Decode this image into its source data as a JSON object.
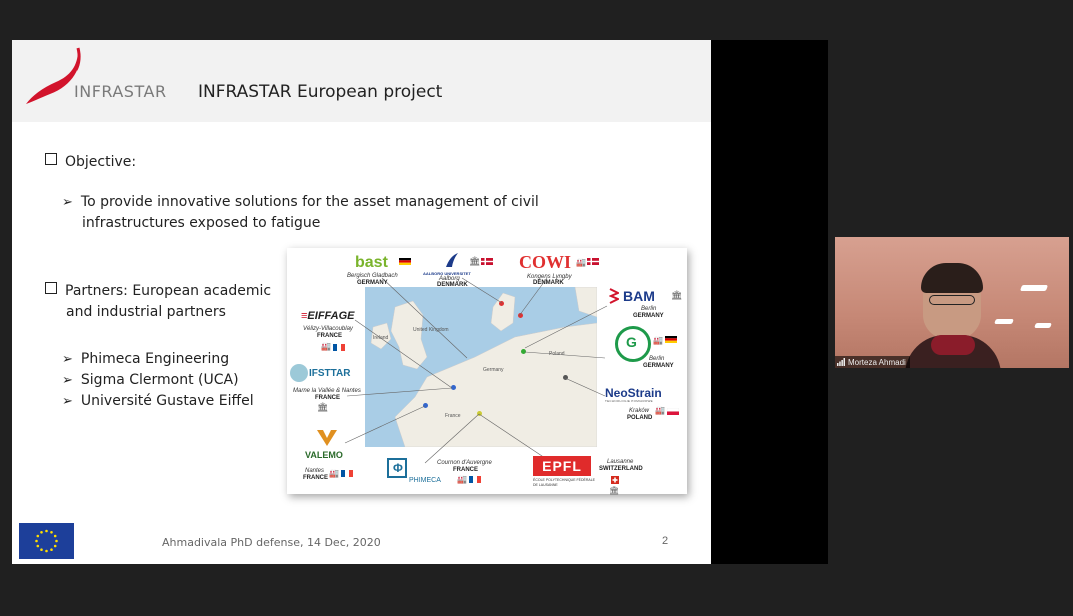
{
  "slide": {
    "logo_text": "INFRASTAR",
    "title": "INFRASTAR European project",
    "objective_heading": "Objective:",
    "objective_line1": "To provide innovative solutions for the asset management of civil",
    "objective_line2": "infrastructures exposed to fatigue",
    "partners_heading_line1": "Partners: European academic",
    "partners_heading_line2": "and industrial partners",
    "partners": [
      "Phimeca Engineering",
      "Sigma Clermont (UCA)",
      "Université Gustave Eiffel"
    ],
    "footer": "Ahmadivala PhD defense, 14 Dec, 2020",
    "page_number": "2"
  },
  "map_figure": {
    "labels": {
      "bast": {
        "brand": "bast",
        "city": "Bergisch Gladbach",
        "country": "GERMANY"
      },
      "aalborg": {
        "brand": "AALBORG UNIVERSITET",
        "city": "Aalborg",
        "country": "DENMARK"
      },
      "cowi": {
        "brand": "COWI",
        "city": "Kongens Lyngby",
        "country": "DENMARK"
      },
      "eiffage": {
        "brand": "EIFFAGE",
        "city": "Vélizy-Villacoublay",
        "country": "FRANCE"
      },
      "bam": {
        "brand": "BAM",
        "city": "Berlin",
        "country": "GERMANY"
      },
      "gd": {
        "city": "Berlin",
        "country": "GERMANY"
      },
      "ifsttar": {
        "brand": "IFSTTAR",
        "city": "Marne la Vallée & Nantes",
        "country": "FRANCE"
      },
      "neostrain": {
        "brand": "NeoStrain",
        "sub": "TECHNOLOGIE POMIAROWE",
        "city": "Kraków",
        "country": "POLAND"
      },
      "valemo": {
        "brand": "VALEMO",
        "city": "Nantes",
        "country": "FRANCE"
      },
      "phimeca": {
        "brand": "PHIMECA",
        "city": "Cournon d'Auvergne",
        "country": "FRANCE"
      },
      "epfl": {
        "brand": "EPFL",
        "sub": "ÉCOLE POLYTECHNIQUE FÉDÉRALE DE LAUSANNE",
        "city": "Lausanne",
        "country": "SWITZERLAND"
      }
    },
    "map_labels": [
      "United Kingdom",
      "Ireland",
      "Germany",
      "Poland",
      "France"
    ]
  },
  "webcam": {
    "participant_name": "Morteza Ahmadi"
  },
  "colors": {
    "brand_red": "#d2142c",
    "eu_blue": "#1d3f9a",
    "eu_star": "#ffdd00"
  }
}
